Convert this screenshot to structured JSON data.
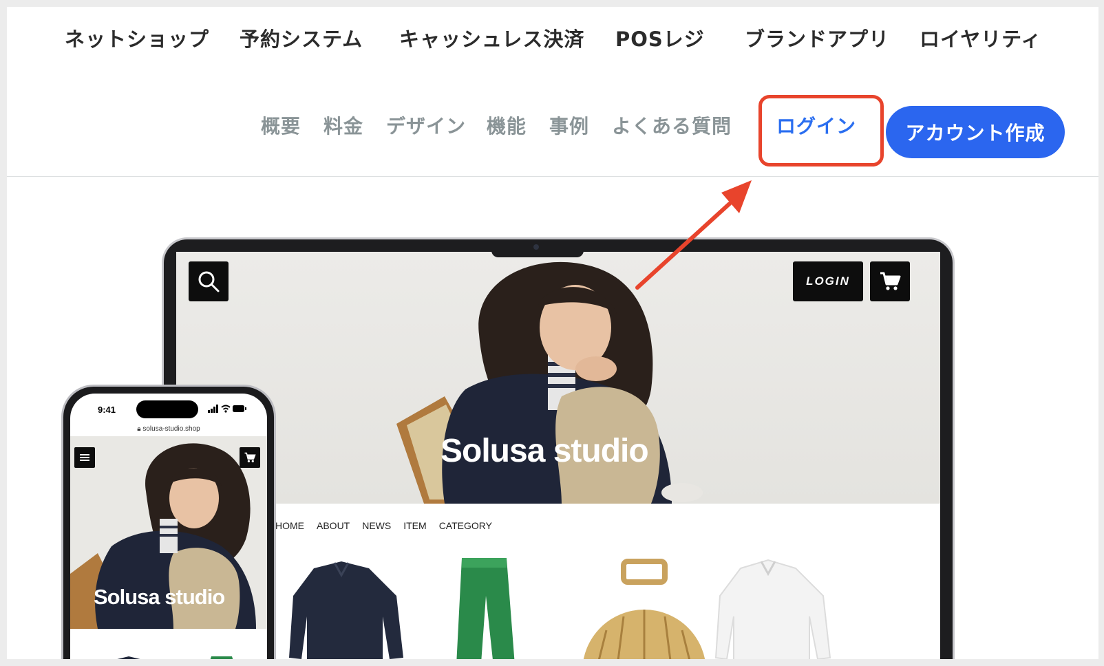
{
  "product_nav": {
    "items": [
      "ネットショップ",
      "予約システム",
      "キャッシュレス決済",
      "POSレジ",
      "ブランドアプリ",
      "ロイヤリティ"
    ]
  },
  "sub_nav": {
    "items": [
      "概要",
      "料金",
      "デザイン",
      "機能",
      "事例",
      "よくある質問"
    ],
    "login": "ログイン",
    "signup": "アカウント作成"
  },
  "colors": {
    "accent": "#2b66ef",
    "highlight": "#e8442c",
    "nav_text": "#2b2b2b",
    "sub_nav_text": "#8a9497"
  },
  "laptop": {
    "login_label": "LOGIN",
    "brand": "Solusa studio",
    "shop_nav": [
      "HOME",
      "ABOUT",
      "NEWS",
      "ITEM",
      "CATEGORY"
    ],
    "icons": [
      "search-icon",
      "cart-icon"
    ]
  },
  "phone": {
    "time": "9:41",
    "url": "solusa-studio.shop",
    "brand": "Solusa studio",
    "icons": [
      "menu-icon",
      "cart-icon",
      "lock-icon",
      "signal-icon",
      "wifi-icon",
      "battery-icon"
    ]
  }
}
